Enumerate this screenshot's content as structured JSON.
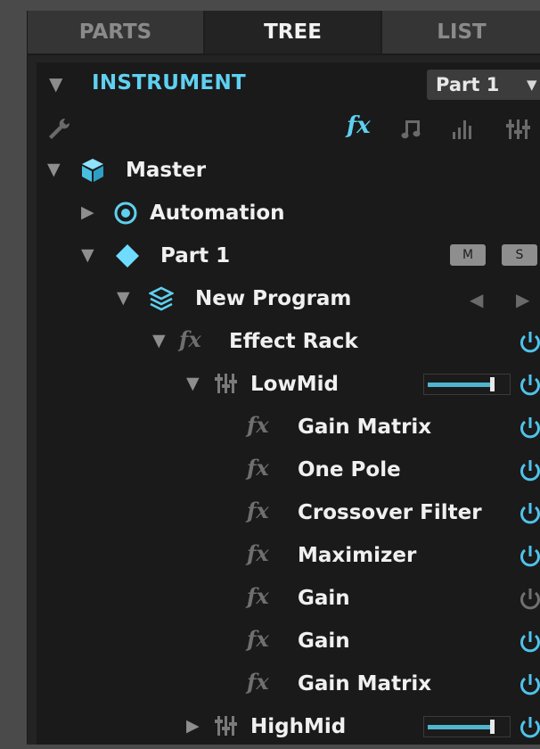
{
  "tabs": [
    {
      "label": "PARTS",
      "active": false
    },
    {
      "label": "TREE",
      "active": true
    },
    {
      "label": "LIST",
      "active": false
    }
  ],
  "header": {
    "title": "INSTRUMENT",
    "part_selector": "Part 1"
  },
  "toolbar": {
    "fx_label": "fx"
  },
  "tree": {
    "master": "Master",
    "automation": "Automation",
    "part": "Part 1",
    "mute_label": "M",
    "solo_label": "S",
    "program": "New Program",
    "effect_rack": "Effect Rack",
    "fx_symbol": "fx",
    "lowmid": {
      "label": "LowMid",
      "slider_level": 0.82
    },
    "effects": [
      {
        "label": "Gain Matrix",
        "enabled": true
      },
      {
        "label": "One Pole",
        "enabled": true
      },
      {
        "label": "Crossover Filter",
        "enabled": true
      },
      {
        "label": "Maximizer",
        "enabled": true
      },
      {
        "label": "Gain",
        "enabled": false
      },
      {
        "label": "Gain",
        "enabled": true
      },
      {
        "label": "Gain Matrix",
        "enabled": true
      }
    ],
    "highmid": {
      "label": "HighMid",
      "slider_level": 0.82
    }
  },
  "colors": {
    "accent": "#5fd0f0",
    "power_on": "#4fc3ea",
    "power_off": "#707070"
  }
}
